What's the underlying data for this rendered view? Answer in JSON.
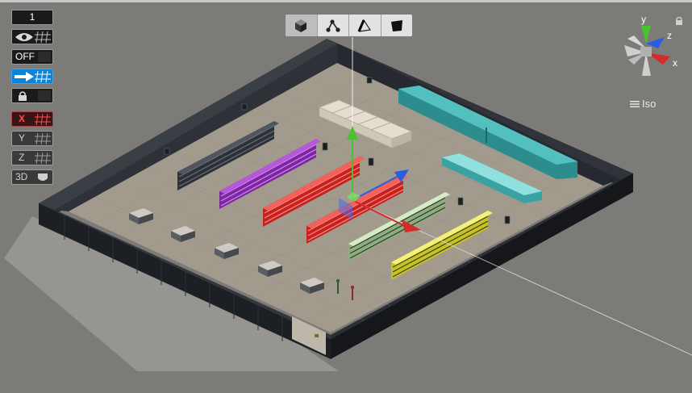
{
  "toolbar": {
    "counter": "1",
    "visibility_icon": "eye-icon",
    "snap_label": "OFF",
    "move_icon": "arrow-right-icon",
    "lock_icon": "lock-icon",
    "x_label": "X",
    "y_label": "Y",
    "z_label": "Z",
    "three_d_label": "3D"
  },
  "modes": [
    {
      "icon": "cube-icon",
      "active": true
    },
    {
      "icon": "vertex-icon",
      "active": false
    },
    {
      "icon": "edge-icon",
      "active": false
    },
    {
      "icon": "face-icon",
      "active": false
    }
  ],
  "gizmo": {
    "x_label": "x",
    "y_label": "y",
    "z_label": "z",
    "projection_label": "Iso"
  },
  "colors": {
    "ground": "#7d7b78",
    "wall": "#23272d",
    "floor": "#a29a8c",
    "shelf_dark": "#3d4148",
    "shelf_purple": "#9a34c2",
    "shelf_red": "#ea3a34",
    "shelf_green": "#b8d4a8",
    "shelf_yellow": "#e6e04a",
    "teal": "#3fa6a6",
    "gizmo_x": "#d42b2b",
    "gizmo_y": "#48c22f",
    "gizmo_z": "#2a5ee0"
  }
}
